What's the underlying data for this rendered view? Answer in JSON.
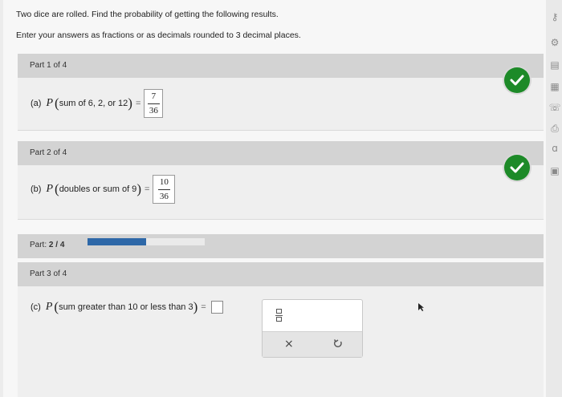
{
  "intro": {
    "line1": "Two dice are rolled. Find the probability of getting the following results.",
    "line2": "Enter your answers as fractions or as decimals rounded to 3 decimal places."
  },
  "part1": {
    "header": "Part 1 of 4",
    "label": "(a)",
    "P": "P",
    "condition": "sum of 6, 2, or 12",
    "eq": "=",
    "numerator": "7",
    "denominator": "36",
    "status_icon": "check-icon",
    "status_color": "#1d8a28"
  },
  "part2": {
    "header": "Part 2 of 4",
    "label": "(b)",
    "P": "P",
    "condition": "doubles or sum of 9",
    "eq": "=",
    "numerator": "10",
    "denominator": "36",
    "status_icon": "check-icon",
    "status_color": "#1d8a28"
  },
  "progress": {
    "label": "Part:",
    "current": "2",
    "separator": "/",
    "total": "4",
    "fraction": 0.5,
    "color": "#2e68a8"
  },
  "part3": {
    "header": "Part 3 of 4",
    "label": "(c)",
    "P": "P",
    "condition": "sum greater than 10 or less than 3",
    "eq": "=",
    "answer_value": ""
  },
  "palette": {
    "fraction_icon": "fraction-template-icon",
    "clear_label": "×",
    "undo_icon": "undo-icon"
  },
  "rail_icons": [
    "key-icon",
    "gear-icon",
    "notebook-icon",
    "calculator-icon",
    "hands-icon",
    "print-icon",
    "text-size-icon",
    "ebook-icon"
  ]
}
